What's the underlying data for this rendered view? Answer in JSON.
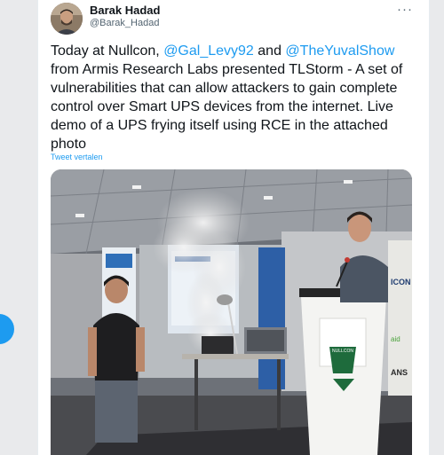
{
  "tweet": {
    "author_name": "Barak Hadad",
    "author_handle": "@Barak_Hadad",
    "more_label": "···",
    "text_part1": "Today at Nullcon, ",
    "mention1": "@Gal_Levy92",
    "text_part2": " and ",
    "mention2": "@TheYuvalShow",
    "text_part3": " from Armis Research Labs presented TLStorm - A set of vulnerabilities that can allow attackers to gain complete control over Smart UPS devices from the internet. Live demo of a UPS frying itself using RCE in the attached photo",
    "translate_label": "Tweet vertalen"
  },
  "photo": {
    "banner_text": "NULLCON",
    "banner_small": "NULLCON",
    "side_text_right": "ICON",
    "side_text_right2": "ANS",
    "side_text_right3": "aid"
  },
  "colors": {
    "accent": "#1d9bf0",
    "text": "#0f1419",
    "secondary": "#536471"
  }
}
